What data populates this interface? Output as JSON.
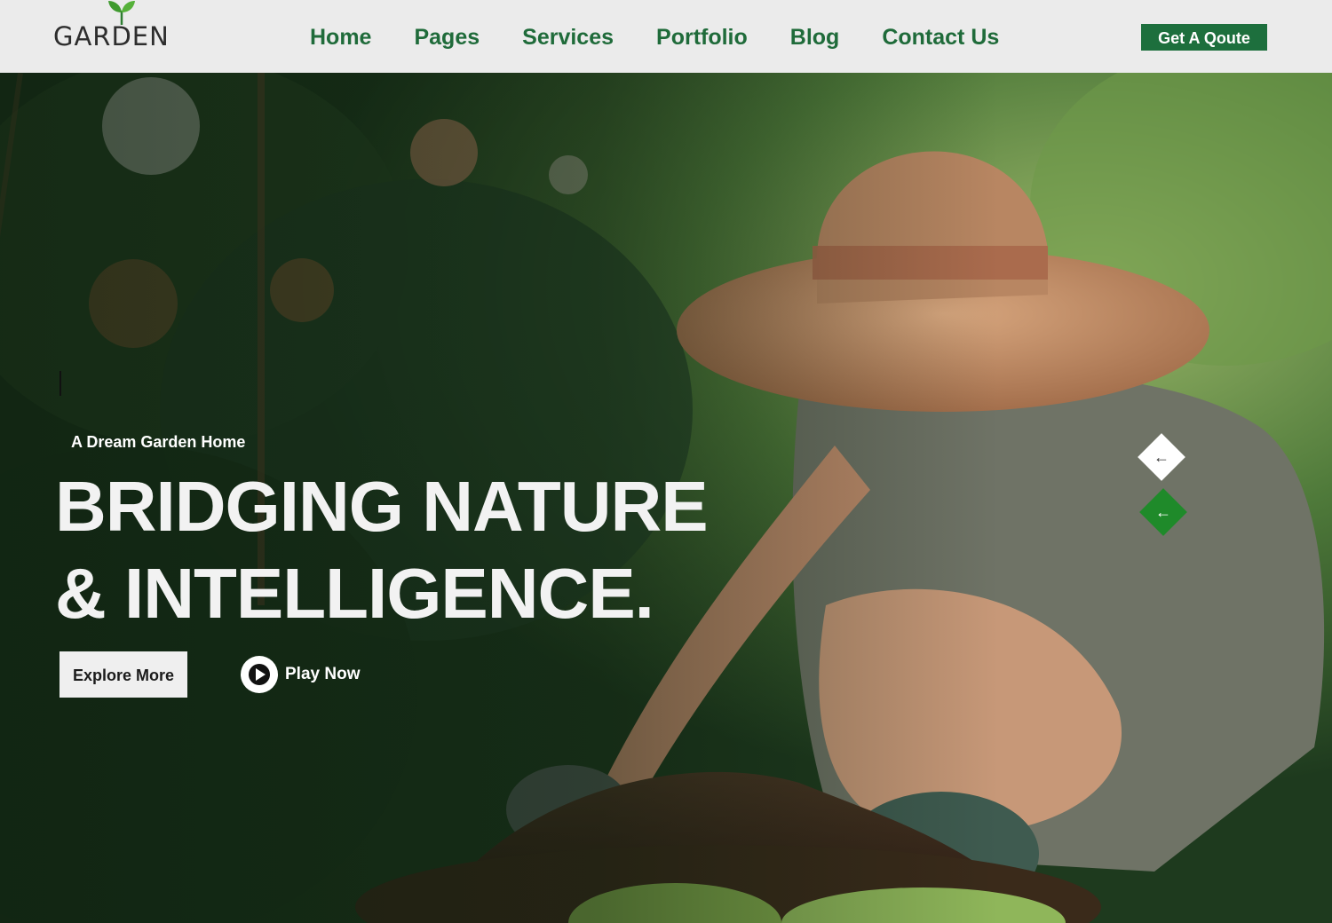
{
  "brand": {
    "name": "GARDEN",
    "color": "#1f6b3a"
  },
  "nav": {
    "items": [
      {
        "label": "Home"
      },
      {
        "label": "Pages"
      },
      {
        "label": "Services"
      },
      {
        "label": "Portfolio"
      },
      {
        "label": "Blog"
      },
      {
        "label": "Contact Us"
      }
    ],
    "cta_label": "Get A Qoute"
  },
  "hero": {
    "eyebrow": "A Dream Garden Home",
    "headline_line1": "BRIDGING NATURE",
    "headline_line2": "& INTELLIGENCE.",
    "explore_label": "Explore More",
    "play_label": "Play Now",
    "image_alt": "woman in straw hat gardening in soil",
    "slider_prev_icon": "arrow-left-icon",
    "slider_next_icon": "arrow-left-icon",
    "accent_green": "#1f8a2a"
  }
}
